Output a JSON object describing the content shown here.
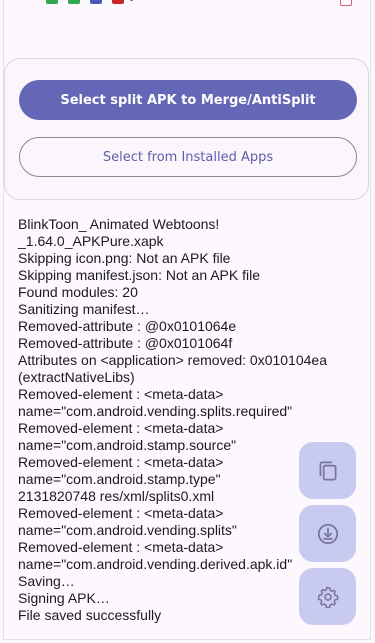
{
  "actions": {
    "primary_label": "Select split APK to Merge/AntiSplit",
    "secondary_label": "Select from Installed Apps"
  },
  "log": [
    "BlinkToon_ Animated Webtoons!",
    "_1.64.0_APKPure.xapk",
    "Skipping icon.png: Not an APK file",
    "Skipping manifest.json: Not an APK file",
    "Found modules: 20",
    "Sanitizing manifest…",
    "Removed-attribute : @0x0101064e",
    "Removed-attribute : @0x0101064f",
    "Attributes on <application> removed: 0x010104ea",
    "(extractNativeLibs)",
    "Removed-element : <meta-data>",
    "name=\"com.android.vending.splits.required\"",
    "Removed-element : <meta-data>",
    "name=\"com.android.stamp.source\"",
    "Removed-element : <meta-data>",
    "name=\"com.android.stamp.type\"",
    "2131820748 res/xml/splits0.xml",
    "Removed-element : <meta-data>",
    "name=\"com.android.vending.splits\"",
    "Removed-element : <meta-data>",
    "name=\"com.android.vending.derived.apk.id\"",
    "Saving…",
    "Signing APK…",
    "File saved successfully"
  ],
  "fabs": [
    {
      "name": "copy-icon"
    },
    {
      "name": "download-icon"
    },
    {
      "name": "settings-icon"
    }
  ],
  "colors": {
    "primary": "#6466b6",
    "fab": "#c7c8ef",
    "background": "#fdf7fe"
  }
}
